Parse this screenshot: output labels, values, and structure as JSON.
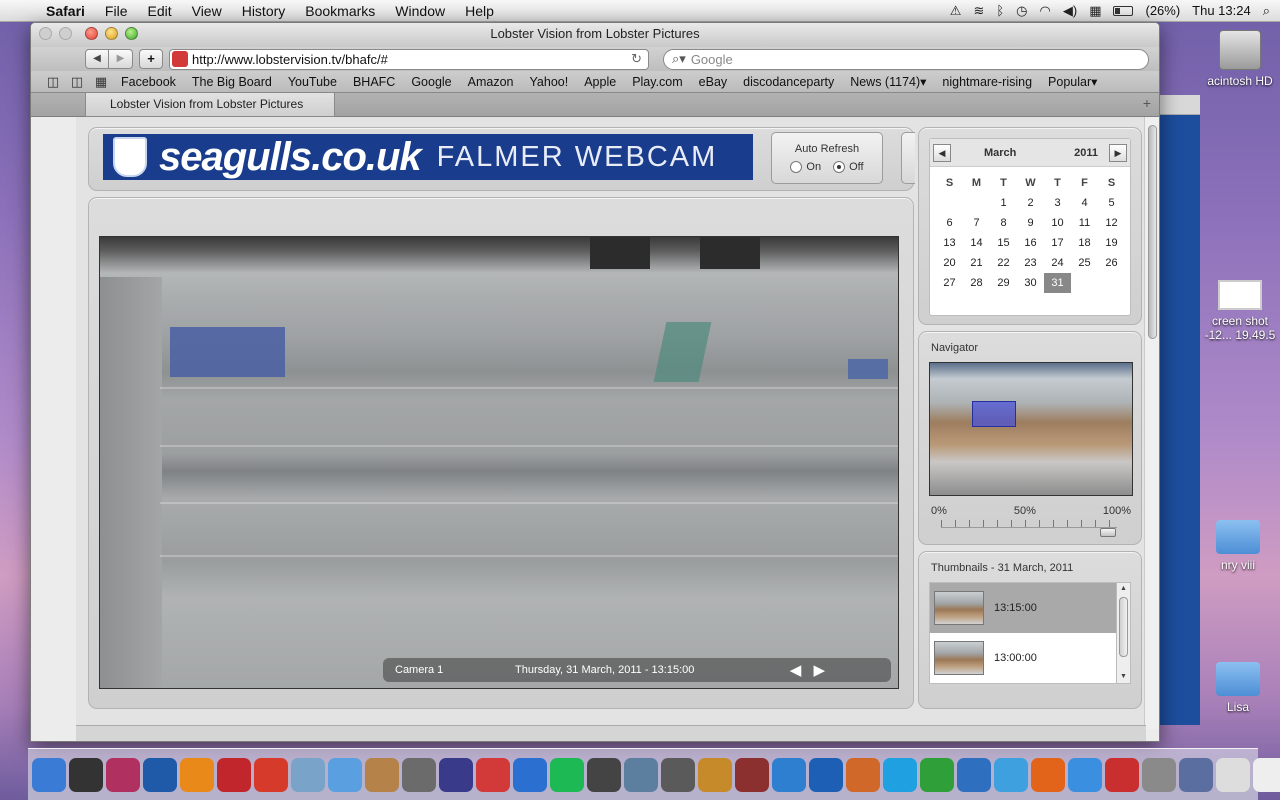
{
  "menubar": {
    "apple_icon": "apple-icon",
    "app_name": "Safari",
    "items": [
      "File",
      "Edit",
      "View",
      "History",
      "Bookmarks",
      "Window",
      "Help"
    ],
    "battery_text": "(26%)",
    "clock": "Thu 13:24"
  },
  "desktop": {
    "hd_label": "acintosh HD",
    "screenshot_label_line1": "creen shot",
    "screenshot_label_line2": "-12... 19.49.5",
    "folder1_label": "nry viii",
    "folder2_label": "Lisa"
  },
  "safari": {
    "window_title": "Lobster Vision from Lobster Pictures",
    "url": "http://www.lobstervision.tv/bhafc/#",
    "search_placeholder": "Google",
    "bookmarks": [
      "Facebook",
      "The Big Board",
      "YouTube",
      "BHAFC",
      "Google",
      "Amazon",
      "Yahoo!",
      "Apple",
      "Play.com",
      "eBay",
      "discodanceparty",
      "News (1174)▾",
      "nightmare-rising",
      "Popular▾"
    ],
    "tab_title": "Lobster Vision from Lobster Pictures"
  },
  "page": {
    "banner_logo": "seagulls.co.uk",
    "banner_subtitle": "FALMER WEBCAM",
    "auto_refresh": {
      "label": "Auto Refresh",
      "on_label": "On",
      "off_label": "Off",
      "selected": "Off"
    },
    "camera": {
      "name": "Camera 1",
      "timestamp": "Thursday, 31 March, 2011 - 13:15:00",
      "arrows": "◀ ▶"
    },
    "calendar": {
      "month": "March",
      "year": "2011",
      "days_of_week": [
        "S",
        "M",
        "T",
        "W",
        "T",
        "F",
        "S"
      ],
      "days": [
        "",
        "",
        "1",
        "2",
        "3",
        "4",
        "5",
        "6",
        "7",
        "8",
        "9",
        "10",
        "11",
        "12",
        "13",
        "14",
        "15",
        "16",
        "17",
        "18",
        "19",
        "20",
        "21",
        "22",
        "23",
        "24",
        "25",
        "26",
        "27",
        "28",
        "29",
        "30",
        "31"
      ],
      "selected_day": "31"
    },
    "navigator": {
      "title": "Navigator",
      "scale_min": "0%",
      "scale_mid": "50%",
      "scale_max": "100%",
      "zoom_level": 0.95
    },
    "thumbnails": {
      "title": "Thumbnails - 31 March, 2011",
      "items": [
        {
          "time": "13:15:00",
          "active": true
        },
        {
          "time": "13:00:00",
          "active": false
        }
      ]
    }
  },
  "dock": {
    "items": [
      "Finder",
      "Dashboard",
      "InDesign",
      "Photoshop",
      "Illustrator",
      "Flash",
      "Acrobat",
      "Preview",
      "iChat",
      "Address Book",
      "iMovie",
      "DVD Player",
      "iCal",
      "iTunes",
      "Spotify",
      "Time Machine",
      "iPhoto",
      "Image Capture",
      "GarageBand",
      "Photo Booth",
      "Safari",
      "Word",
      "PowerPoint",
      "Skype",
      "Network",
      "QuickTime",
      "Messenger",
      "Firefox",
      "MSN",
      "Stickies",
      "Media Encoder",
      "Preferences",
      "Document",
      "Document 2",
      "Trash"
    ]
  }
}
